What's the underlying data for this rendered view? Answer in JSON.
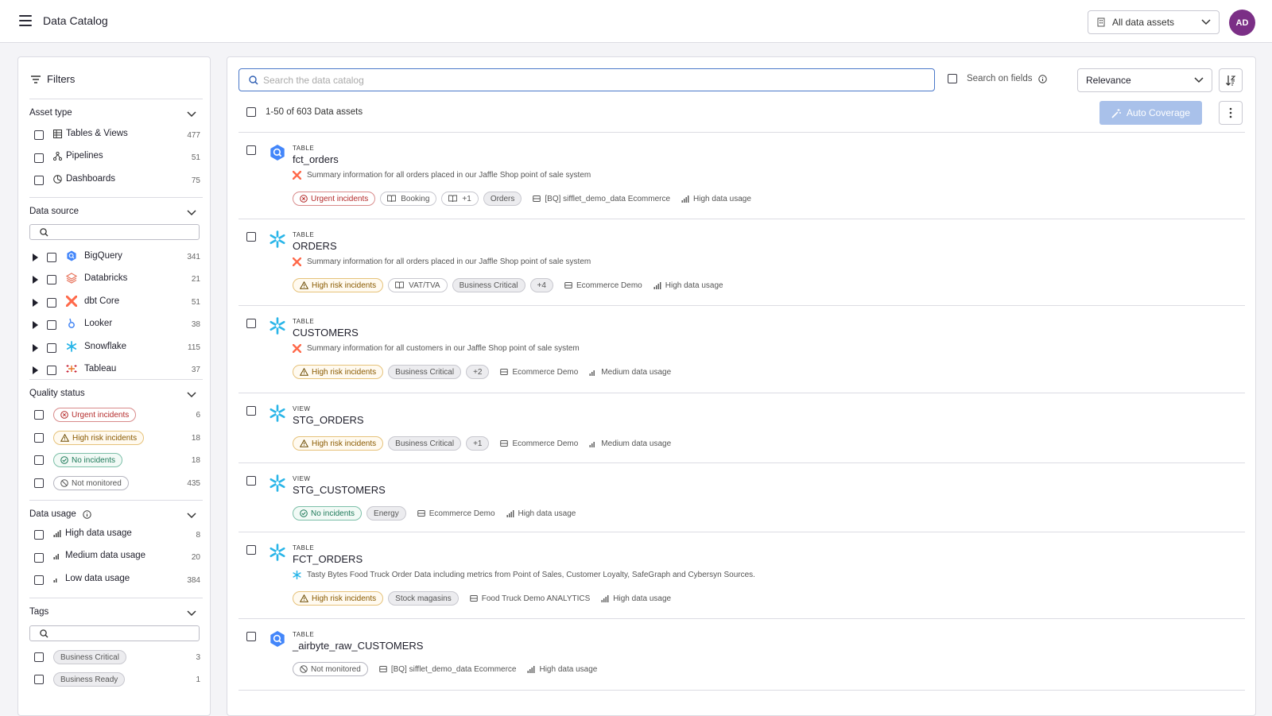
{
  "header": {
    "title": "Data Catalog",
    "asset_selector": "All data assets",
    "avatar_initials": "AD"
  },
  "sidebar": {
    "title": "Filters",
    "asset_type": {
      "title": "Asset type",
      "items": [
        {
          "label": "Tables & Views",
          "count": "477"
        },
        {
          "label": "Pipelines",
          "count": "51"
        },
        {
          "label": "Dashboards",
          "count": "75"
        }
      ]
    },
    "data_source": {
      "title": "Data source",
      "items": [
        {
          "label": "BigQuery",
          "count": "341"
        },
        {
          "label": "Databricks",
          "count": "21"
        },
        {
          "label": "dbt Core",
          "count": "51"
        },
        {
          "label": "Looker",
          "count": "38"
        },
        {
          "label": "Snowflake",
          "count": "115"
        },
        {
          "label": "Tableau",
          "count": "37"
        }
      ]
    },
    "quality_status": {
      "title": "Quality status",
      "items": [
        {
          "label": "Urgent incidents",
          "count": "6"
        },
        {
          "label": "High risk incidents",
          "count": "18"
        },
        {
          "label": "No incidents",
          "count": "18"
        },
        {
          "label": "Not monitored",
          "count": "435"
        }
      ]
    },
    "data_usage": {
      "title": "Data usage",
      "items": [
        {
          "label": "High data usage",
          "count": "8"
        },
        {
          "label": "Medium data usage",
          "count": "20"
        },
        {
          "label": "Low data usage",
          "count": "384"
        }
      ]
    },
    "tags": {
      "title": "Tags",
      "items": [
        {
          "label": "Business Critical",
          "count": "3"
        },
        {
          "label": "Business Ready",
          "count": "1"
        }
      ]
    }
  },
  "main": {
    "search_placeholder": "Search the data catalog",
    "search_on_fields": "Search on fields",
    "sort_select": "Relevance",
    "result_count": "1-50 of 603 Data assets",
    "auto_coverage": "Auto Coverage",
    "results": [
      {
        "kind": "TABLE",
        "name": "fct_orders",
        "source": "bigquery",
        "desc_source": "dbt",
        "desc": "Summary information for all orders placed in our Jaffle Shop point of sale system",
        "status": "Urgent incidents",
        "status_type": "urgent",
        "tags": [
          "Booking",
          "+1",
          "Orders"
        ],
        "tag_styles": [
          "out-book",
          "out-book",
          "tag"
        ],
        "location": "[BQ] sifflet_demo_data Ecommerce",
        "usage": "High data usage"
      },
      {
        "kind": "TABLE",
        "name": "ORDERS",
        "source": "snowflake",
        "desc_source": "dbt",
        "desc": "Summary information for all orders placed in our Jaffle Shop point of sale system",
        "status": "High risk incidents",
        "status_type": "high",
        "tags": [
          "VAT/TVA",
          "Business Critical",
          "+4"
        ],
        "tag_styles": [
          "out-book",
          "tag",
          "tag"
        ],
        "location": "Ecommerce Demo",
        "usage": "High data usage"
      },
      {
        "kind": "TABLE",
        "name": "CUSTOMERS",
        "source": "snowflake",
        "desc_source": "dbt",
        "desc": "Summary information for all customers in our Jaffle Shop point of sale system",
        "status": "High risk incidents",
        "status_type": "high",
        "tags": [
          "Business Critical",
          "+2"
        ],
        "tag_styles": [
          "tag",
          "tag"
        ],
        "location": "Ecommerce Demo",
        "usage": "Medium data usage"
      },
      {
        "kind": "VIEW",
        "name": "STG_ORDERS",
        "source": "snowflake",
        "desc_source": "",
        "desc": "",
        "status": "High risk incidents",
        "status_type": "high",
        "tags": [
          "Business Critical",
          "+1"
        ],
        "tag_styles": [
          "tag",
          "tag"
        ],
        "location": "Ecommerce Demo",
        "usage": "Medium data usage"
      },
      {
        "kind": "VIEW",
        "name": "STG_CUSTOMERS",
        "source": "snowflake",
        "desc_source": "",
        "desc": "",
        "status": "No incidents",
        "status_type": "none",
        "tags": [
          "Energy"
        ],
        "tag_styles": [
          "tag"
        ],
        "location": "Ecommerce Demo",
        "usage": "High data usage"
      },
      {
        "kind": "TABLE",
        "name": "FCT_ORDERS",
        "source": "snowflake",
        "desc_source": "snowflake",
        "desc": "Tasty Bytes Food Truck Order Data including metrics from Point of Sales, Customer Loyalty, SafeGraph and Cybersyn Sources.",
        "status": "High risk incidents",
        "status_type": "high",
        "tags": [
          "Stock magasins"
        ],
        "tag_styles": [
          "tag"
        ],
        "location": "Food Truck Demo ANALYTICS",
        "usage": "High data usage"
      },
      {
        "kind": "TABLE",
        "name": "_airbyte_raw_CUSTOMERS",
        "source": "bigquery",
        "desc_source": "",
        "desc": "",
        "status": "Not monitored",
        "status_type": "notmon",
        "tags": [],
        "tag_styles": [],
        "location": "[BQ] sifflet_demo_data Ecommerce",
        "usage": "High data usage"
      }
    ]
  },
  "colors": {
    "accent": "#4a78c9",
    "avatar": "#7b2f86",
    "auto_coverage_disabled": "#a9c1ea",
    "urgent": "#b42b2b",
    "high_risk": "#8a5a00",
    "no_incidents": "#1f7a5a"
  }
}
